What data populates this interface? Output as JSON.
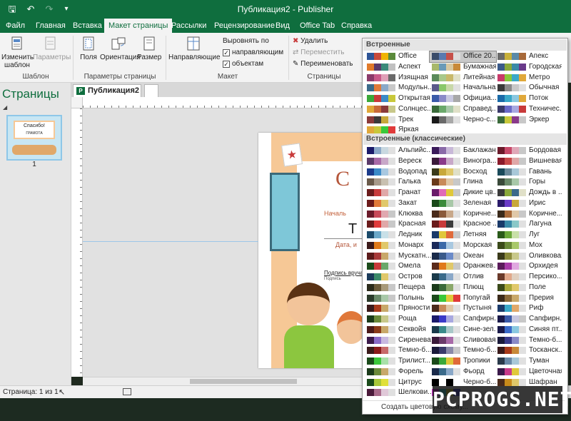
{
  "titlebar": {
    "title": "Публикация2 - Publisher",
    "save_icon": "save-icon",
    "undo_icon": "undo-icon",
    "redo_icon": "redo-icon"
  },
  "tabs": [
    "Файл",
    "Главная",
    "Вставка",
    "Макет страницы",
    "Рассылки",
    "Рецензирование",
    "Вид",
    "Office Tab",
    "Справка"
  ],
  "active_tab": "Макет страницы",
  "ribbon": {
    "template_group": {
      "label": "Шаблон",
      "change_template": "Изменить шаблон",
      "params": "Параметры"
    },
    "page_setup_group": {
      "label": "Параметры страницы",
      "margins": "Поля",
      "orientation": "Ориентация",
      "size": "Размер"
    },
    "layout_group": {
      "label": "Макет",
      "guides": "Направляющие",
      "align_by": "Выровнять по",
      "align_guides": "направляющим",
      "align_objects": "объектам"
    },
    "pages_group": {
      "label": "Страницы",
      "delete": "Удалить",
      "move": "Переместить",
      "rename": "Переименовать"
    }
  },
  "pages_pane": {
    "title": "Страницы",
    "thumb_number": "1",
    "thumb_text_1": "Спасибо!",
    "thumb_text_2": "ГРАМОТА"
  },
  "doc_tab": {
    "label": "Публикация2",
    "icon": "P"
  },
  "document": {
    "big_letter": "С",
    "line1": "Началь",
    "line2": "Т",
    "line3": "Дата, и",
    "line4": "Подпись вруча",
    "line5": "Подпись"
  },
  "status": {
    "page_info": "Страница: 1 из 1"
  },
  "dropdown": {
    "section_builtin": "Встроенные",
    "section_classic": "Встроенные (классические)",
    "create_link": "Создать цветовую схему...",
    "builtin": [
      {
        "name": "Office",
        "colors": [
          "#2e5597",
          "#c94a3b",
          "#f0b400",
          "#5a8a3a"
        ]
      },
      {
        "name": "Office 20...",
        "colors": [
          "#3a4c6a",
          "#5a7ab0",
          "#c6504a",
          "#dcdcdc"
        ],
        "selected": true
      },
      {
        "name": "Апекс",
        "colors": [
          "#6a6a6a",
          "#c8b03a",
          "#5a8aa8",
          "#a86a3a"
        ]
      },
      {
        "name": "Аспект",
        "colors": [
          "#e07a2a",
          "#5a3a6a",
          "#3a8a7a",
          "#c0c0c0"
        ]
      },
      {
        "name": "Бумажная",
        "colors": [
          "#a8b86a",
          "#6a9ab8",
          "#d8c8a0",
          "#c88a3a"
        ]
      },
      {
        "name": "Городская",
        "colors": [
          "#3a5a8a",
          "#8aa83a",
          "#3a8aa8",
          "#6a3a8a"
        ]
      },
      {
        "name": "Изящная",
        "colors": [
          "#8a3a6a",
          "#c85a8a",
          "#e0a0b8",
          "#6a6a6a"
        ]
      },
      {
        "name": "Литейная",
        "colors": [
          "#5a8a5a",
          "#a8c88a",
          "#c8b86a",
          "#e0e0c8"
        ]
      },
      {
        "name": "Метро",
        "colors": [
          "#c83a6a",
          "#8ac83a",
          "#3aa8c8",
          "#e0a83a"
        ]
      },
      {
        "name": "Модульн...",
        "colors": [
          "#3a6a8a",
          "#e07a3a",
          "#8aa8c8",
          "#c8c8c8"
        ]
      },
      {
        "name": "Начальная",
        "colors": [
          "#5a5a8a",
          "#8ac86a",
          "#c8d8a8",
          "#e0e0e0"
        ]
      },
      {
        "name": "Обычная",
        "colors": [
          "#3a3a3a",
          "#8a8a8a",
          "#c8c8c8",
          "#e0e0e0"
        ]
      },
      {
        "name": "Открытая",
        "colors": [
          "#3aa83a",
          "#c83a3a",
          "#3a8ac8",
          "#c8c83a"
        ]
      },
      {
        "name": "Официа...",
        "colors": [
          "#3a5aa8",
          "#8a8ac8",
          "#c8c8e0",
          "#a8a8a8"
        ]
      },
      {
        "name": "Поток",
        "colors": [
          "#1a6aa8",
          "#3aa8c8",
          "#8ac8e0",
          "#e0a83a"
        ]
      },
      {
        "name": "Солнцес...",
        "colors": [
          "#e0a83a",
          "#c86a3a",
          "#8a3a3a",
          "#c8c88a"
        ]
      },
      {
        "name": "Справед...",
        "colors": [
          "#3a6a3a",
          "#6aa86a",
          "#a8c8a8",
          "#e0e0c8"
        ]
      },
      {
        "name": "Техничес...",
        "colors": [
          "#3a3a6a",
          "#6a6ac8",
          "#a8a8e0",
          "#c83a3a"
        ]
      },
      {
        "name": "Трек",
        "colors": [
          "#8a3a3a",
          "#3a3a3a",
          "#c8a83a",
          "#e0e0e0"
        ]
      },
      {
        "name": "Черно-с...",
        "colors": [
          "#1a1a1a",
          "#6a6a6a",
          "#a8a8a8",
          "#e0e0e0"
        ]
      },
      {
        "name": "Эркер",
        "colors": [
          "#3a6a3a",
          "#c8c83a",
          "#8a3a8a",
          "#c8c8c8"
        ]
      },
      {
        "name": "Яркая",
        "colors": [
          "#e0a83a",
          "#c8c83a",
          "#3ac83a",
          "#e03a3a"
        ]
      }
    ],
    "classic": [
      {
        "name": "Альпийс...",
        "colors": [
          "#1a1a6a",
          "#8aa8c8",
          "#c8d8e0",
          "#e0e0e0"
        ]
      },
      {
        "name": "Баклажан",
        "colors": [
          "#3a1a5a",
          "#8a6aa8",
          "#c8b8d8",
          "#e0e0e0"
        ]
      },
      {
        "name": "Бордовая",
        "colors": [
          "#6a1a2a",
          "#c84a6a",
          "#e0a8b8",
          "#c8c8c8"
        ]
      },
      {
        "name": "Вереск",
        "colors": [
          "#5a3a6a",
          "#a86aa8",
          "#c8a8c8",
          "#e0e0e0"
        ]
      },
      {
        "name": "Виногра...",
        "colors": [
          "#3a1a3a",
          "#8a3a8a",
          "#c8a8c8",
          "#e0e0e0"
        ]
      },
      {
        "name": "Вишневая",
        "colors": [
          "#8a1a2a",
          "#c84a4a",
          "#e0a8a8",
          "#c8c8c8"
        ]
      },
      {
        "name": "Водопад",
        "colors": [
          "#1a3a8a",
          "#3a8ac8",
          "#a8c8e0",
          "#e0e0e0"
        ]
      },
      {
        "name": "Восход",
        "colors": [
          "#3a3a1a",
          "#c8a83a",
          "#e0c86a",
          "#e0e0c8"
        ]
      },
      {
        "name": "Гавань",
        "colors": [
          "#1a4a5a",
          "#6a8a9a",
          "#a8c8d8",
          "#e0e0e0"
        ]
      },
      {
        "name": "Галька",
        "colors": [
          "#6a5a4a",
          "#a89a8a",
          "#c8c0b0",
          "#e0e0e0"
        ]
      },
      {
        "name": "Глина",
        "colors": [
          "#6a3a1a",
          "#c88a5a",
          "#e0c8a8",
          "#c8c8c8"
        ]
      },
      {
        "name": "Горы",
        "colors": [
          "#3a4a3a",
          "#6a8a6a",
          "#a8c8a8",
          "#e0e0e0"
        ]
      },
      {
        "name": "Гранат",
        "colors": [
          "#6a1a1a",
          "#c83a3a",
          "#e0a8a8",
          "#e0e0e0"
        ]
      },
      {
        "name": "Дикие цв...",
        "colors": [
          "#6a1a6a",
          "#e06ab8",
          "#e0c83a",
          "#c8c8c8"
        ]
      },
      {
        "name": "Дождь в ...",
        "colors": [
          "#3a3a3a",
          "#8aa83a",
          "#3a6a8a",
          "#e0e0c8"
        ]
      },
      {
        "name": "Закат",
        "colors": [
          "#6a1a1a",
          "#e07a3a",
          "#e0c86a",
          "#e0e0e0"
        ]
      },
      {
        "name": "Зеленая",
        "colors": [
          "#1a4a1a",
          "#3a8a3a",
          "#a8c8a8",
          "#e0e0e0"
        ]
      },
      {
        "name": "Ирис",
        "colors": [
          "#2a1a6a",
          "#6a3ac8",
          "#c8a83a",
          "#e0e0e0"
        ]
      },
      {
        "name": "Клюква",
        "colors": [
          "#6a1a2a",
          "#c84a5a",
          "#e0a8b0",
          "#c8c8c8"
        ]
      },
      {
        "name": "Коричне...",
        "colors": [
          "#4a2a1a",
          "#8a5a3a",
          "#c8a88a",
          "#e0e0e0"
        ]
      },
      {
        "name": "Коричне...",
        "colors": [
          "#3a2a1a",
          "#a86a3a",
          "#e0c8a8",
          "#c8c8c8"
        ]
      },
      {
        "name": "Красная",
        "colors": [
          "#6a1a1a",
          "#e03a3a",
          "#e0a8a8",
          "#c8c8c8"
        ]
      },
      {
        "name": "Красное ...",
        "colors": [
          "#6a1a1a",
          "#c83a3a",
          "#3a3a3a",
          "#e0e0e0"
        ]
      },
      {
        "name": "Лагуна",
        "colors": [
          "#1a3a6a",
          "#3a8aa8",
          "#8ac8c8",
          "#e0e0e0"
        ]
      },
      {
        "name": "Ледник",
        "colors": [
          "#1a4a6a",
          "#6aa8c8",
          "#c8e0e8",
          "#e0e0e0"
        ]
      },
      {
        "name": "Летняя",
        "colors": [
          "#1a3a6a",
          "#e0c83a",
          "#e06a3a",
          "#c8c8c8"
        ]
      },
      {
        "name": "Луг",
        "colors": [
          "#2a5a1a",
          "#6aa83a",
          "#c8e0a8",
          "#e0e0e0"
        ]
      },
      {
        "name": "Монарх",
        "colors": [
          "#3a1a1a",
          "#e07a1a",
          "#e0c86a",
          "#e0e0e0"
        ]
      },
      {
        "name": "Морская",
        "colors": [
          "#1a2a5a",
          "#3a6aa8",
          "#a8c8e0",
          "#e0e0e0"
        ]
      },
      {
        "name": "Мох",
        "colors": [
          "#3a4a1a",
          "#6a8a3a",
          "#a8c86a",
          "#e0e0e0"
        ]
      },
      {
        "name": "Мускатн...",
        "colors": [
          "#5a1a1a",
          "#a83a3a",
          "#c8a86a",
          "#e0e0e0"
        ]
      },
      {
        "name": "Океан",
        "colors": [
          "#1a2a4a",
          "#3a5a8a",
          "#6a8ac8",
          "#c8c8c8"
        ]
      },
      {
        "name": "Оливковая",
        "colors": [
          "#3a3a1a",
          "#8a8a3a",
          "#c8c88a",
          "#e0e0e0"
        ]
      },
      {
        "name": "Омела",
        "colors": [
          "#1a4a1a",
          "#c83a3a",
          "#6aa86a",
          "#e0e0e0"
        ]
      },
      {
        "name": "Оранжев...",
        "colors": [
          "#5a2a1a",
          "#e07a1a",
          "#e0c86a",
          "#c8c8c8"
        ]
      },
      {
        "name": "Орхидея",
        "colors": [
          "#5a1a5a",
          "#a83aa8",
          "#e0a8e0",
          "#e0e0e0"
        ]
      },
      {
        "name": "Остров",
        "colors": [
          "#1a3a5a",
          "#3a8a6a",
          "#e0c86a",
          "#e0e0e0"
        ]
      },
      {
        "name": "Отлив",
        "colors": [
          "#1a3a4a",
          "#3a6a8a",
          "#8aa8c8",
          "#e0e0e0"
        ]
      },
      {
        "name": "Персико...",
        "colors": [
          "#6a3a2a",
          "#e0a88a",
          "#e0d0c0",
          "#e0e0e0"
        ]
      },
      {
        "name": "Пещера",
        "colors": [
          "#2a2a1a",
          "#6a5a3a",
          "#a89a7a",
          "#c8c8c8"
        ]
      },
      {
        "name": "Плющ",
        "colors": [
          "#1a3a1a",
          "#3a6a3a",
          "#8aa86a",
          "#e0e0e0"
        ]
      },
      {
        "name": "Поле",
        "colors": [
          "#3a4a1a",
          "#a8a83a",
          "#e0c86a",
          "#e0e0e0"
        ]
      },
      {
        "name": "Полынь",
        "colors": [
          "#2a3a2a",
          "#6a8a6a",
          "#a8c8a8",
          "#c8c8c8"
        ]
      },
      {
        "name": "Попугай",
        "colors": [
          "#1a4a1a",
          "#3ac83a",
          "#e0c83a",
          "#e03a3a"
        ]
      },
      {
        "name": "Прерия",
        "colors": [
          "#3a2a1a",
          "#8a6a3a",
          "#c8a86a",
          "#e0e0e0"
        ]
      },
      {
        "name": "Пряности",
        "colors": [
          "#3a1a1a",
          "#a83a1a",
          "#c8a86a",
          "#e0e0e0"
        ]
      },
      {
        "name": "Пустыня",
        "colors": [
          "#4a2a1a",
          "#c88a5a",
          "#e0c8a8",
          "#e0e0e0"
        ]
      },
      {
        "name": "Риф",
        "colors": [
          "#1a3a6a",
          "#3aa8c8",
          "#e0a86a",
          "#e0e0e0"
        ]
      },
      {
        "name": "Роща",
        "colors": [
          "#1a3a1a",
          "#6a8a3a",
          "#c8c88a",
          "#e0e0e0"
        ]
      },
      {
        "name": "Сапфирн...",
        "colors": [
          "#1a1a6a",
          "#3a3ac8",
          "#a8a8e0",
          "#e0e0e0"
        ]
      },
      {
        "name": "Сапфирн...",
        "colors": [
          "#1a1a4a",
          "#3a5aa8",
          "#c8c8e0",
          "#c8c8c8"
        ]
      },
      {
        "name": "Секвойя",
        "colors": [
          "#4a1a1a",
          "#8a3a1a",
          "#c8a86a",
          "#e0e0e0"
        ]
      },
      {
        "name": "Сине-зел...",
        "colors": [
          "#1a3a4a",
          "#3a8a8a",
          "#a8c8c8",
          "#e0e0e0"
        ]
      },
      {
        "name": "Синяя пт...",
        "colors": [
          "#1a1a4a",
          "#3a6ac8",
          "#8ac8e0",
          "#e0e0e0"
        ]
      },
      {
        "name": "Сиреневая",
        "colors": [
          "#3a1a4a",
          "#8a6ac8",
          "#c8b8e0",
          "#e0e0e0"
        ]
      },
      {
        "name": "Сливовая",
        "colors": [
          "#3a1a3a",
          "#6a3a6a",
          "#a86aa8",
          "#e0e0e0"
        ]
      },
      {
        "name": "Темно-б...",
        "colors": [
          "#1a1a3a",
          "#3a3a8a",
          "#8a8ac8",
          "#e0e0e0"
        ]
      },
      {
        "name": "Темно-б...",
        "colors": [
          "#3a1a1a",
          "#8a1a1a",
          "#c86a6a",
          "#e0e0e0"
        ]
      },
      {
        "name": "Темно-б...",
        "colors": [
          "#1a1a3a",
          "#3a3a6a",
          "#8a8aa8",
          "#c8c8c8"
        ]
      },
      {
        "name": "Тосканск...",
        "colors": [
          "#3a1a1a",
          "#a83a1a",
          "#c88a3a",
          "#e0e0e0"
        ]
      },
      {
        "name": "Трилист...",
        "colors": [
          "#1a4a1a",
          "#3ac83a",
          "#a8e0a8",
          "#e0e0e0"
        ]
      },
      {
        "name": "Тропики",
        "colors": [
          "#1a4a1a",
          "#3aa83a",
          "#e0c83a",
          "#e06a3a"
        ]
      },
      {
        "name": "Туман",
        "colors": [
          "#2a3a4a",
          "#6a8aa8",
          "#a8c8d8",
          "#e0e0e0"
        ]
      },
      {
        "name": "Форель",
        "colors": [
          "#1a3a1a",
          "#6a8a3a",
          "#c8a86a",
          "#e0e0e0"
        ]
      },
      {
        "name": "Фьорд",
        "colors": [
          "#1a2a4a",
          "#3a6a8a",
          "#8aa8c8",
          "#e0e0e0"
        ]
      },
      {
        "name": "Цветочная",
        "colors": [
          "#3a1a4a",
          "#c83a8a",
          "#e0c83a",
          "#e0e0e0"
        ]
      },
      {
        "name": "Цитрус",
        "colors": [
          "#1a4a1a",
          "#a8c83a",
          "#e0e03a",
          "#e0e0e0"
        ]
      },
      {
        "name": "Черно-б...",
        "colors": [
          "#000000",
          "#ffffff",
          "#000000",
          "#ffffff"
        ]
      },
      {
        "name": "Шафран",
        "colors": [
          "#4a2a1a",
          "#c88a1a",
          "#e0c86a",
          "#e0e0e0"
        ]
      },
      {
        "name": "Шелкови...",
        "colors": [
          "#4a1a3a",
          "#a86a8a",
          "#e0c8d8",
          "#e0e0e0"
        ]
      },
      {
        "name": "",
        "colors": [
          "#e03ae0",
          "#3ae0e0",
          "#e0e03a",
          "#3a3ae0"
        ]
      }
    ]
  },
  "watermark": "PCPROGS.NET"
}
